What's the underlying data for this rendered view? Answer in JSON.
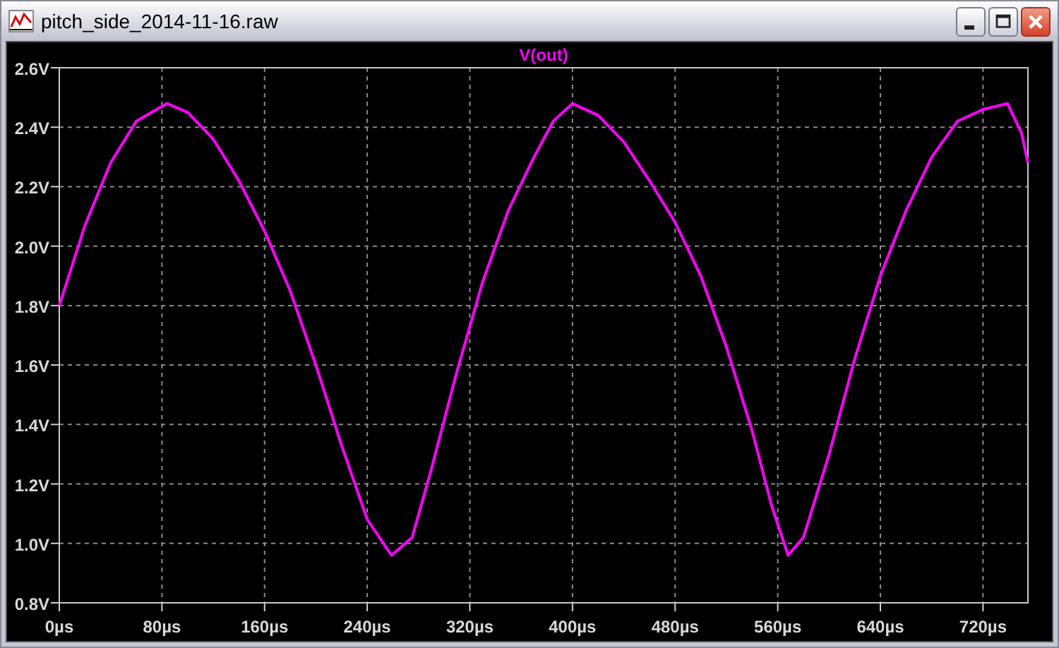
{
  "window": {
    "title": "pitch_side_2014-11-16.raw"
  },
  "plot": {
    "chart_data": {
      "type": "line",
      "grid": true,
      "x": [
        0,
        20,
        40,
        60,
        84,
        100,
        120,
        140,
        160,
        180,
        200,
        220,
        240,
        259,
        275,
        290,
        310,
        330,
        350,
        370,
        385,
        400,
        420,
        440,
        460,
        480,
        500,
        520,
        540,
        555,
        568,
        580,
        600,
        620,
        640,
        660,
        680,
        700,
        720,
        739,
        750,
        755
      ],
      "series": [
        {
          "name": "V(out)",
          "color": "#ff00ff",
          "values": [
            1.8,
            2.07,
            2.28,
            2.42,
            2.48,
            2.45,
            2.36,
            2.22,
            2.05,
            1.85,
            1.6,
            1.33,
            1.08,
            0.96,
            1.02,
            1.25,
            1.58,
            1.88,
            2.12,
            2.3,
            2.42,
            2.48,
            2.44,
            2.35,
            2.22,
            2.08,
            1.9,
            1.66,
            1.38,
            1.13,
            0.96,
            1.02,
            1.3,
            1.62,
            1.9,
            2.12,
            2.3,
            2.42,
            2.46,
            2.48,
            2.38,
            2.28
          ]
        }
      ],
      "xlim": [
        0,
        755
      ],
      "ylim": [
        0.8,
        2.6
      ],
      "xticks": [
        {
          "value": 0,
          "label": "0µs"
        },
        {
          "value": 80,
          "label": "80µs"
        },
        {
          "value": 160,
          "label": "160µs"
        },
        {
          "value": 240,
          "label": "240µs"
        },
        {
          "value": 320,
          "label": "320µs"
        },
        {
          "value": 400,
          "label": "400µs"
        },
        {
          "value": 480,
          "label": "480µs"
        },
        {
          "value": 560,
          "label": "560µs"
        },
        {
          "value": 640,
          "label": "640µs"
        },
        {
          "value": 720,
          "label": "720µs"
        }
      ],
      "yticks": [
        {
          "value": 0.8,
          "label": "0.8V"
        },
        {
          "value": 1.0,
          "label": "1.0V"
        },
        {
          "value": 1.2,
          "label": "1.2V"
        },
        {
          "value": 1.4,
          "label": "1.4V"
        },
        {
          "value": 1.6,
          "label": "1.6V"
        },
        {
          "value": 1.8,
          "label": "1.8V"
        },
        {
          "value": 2.0,
          "label": "2.0V"
        },
        {
          "value": 2.2,
          "label": "2.2V"
        },
        {
          "value": 2.4,
          "label": "2.4V"
        },
        {
          "value": 2.6,
          "label": "2.6V"
        }
      ]
    }
  }
}
